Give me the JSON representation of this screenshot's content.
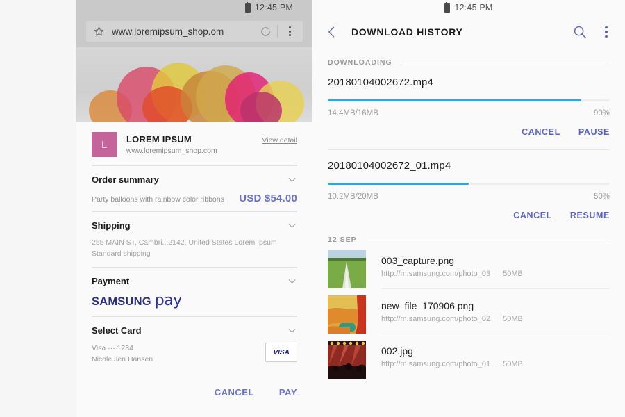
{
  "left": {
    "status": {
      "time": "12:45 PM",
      "battery_icon": "battery-icon"
    },
    "browser": {
      "url": "www.loremipsum_shop.om",
      "star_icon": "star-icon",
      "reload_icon": "reload-icon",
      "menu_icon": "kebab-menu-icon"
    },
    "merchant": {
      "avatar_letter": "L",
      "name": "LOREM IPSUM",
      "url": "www.loremipsum_shop.com",
      "view_detail": "View detail"
    },
    "order": {
      "title": "Order summary",
      "description": "Party balloons with rainbow color ribbons",
      "price": "USD $54.00"
    },
    "shipping": {
      "title": "Shipping",
      "address": "255 MAIN ST, Cambri...2142, United States Lorem Ipsum",
      "method": "Standard shipping"
    },
    "payment": {
      "title": "Payment",
      "brand_first": "SAMSUNG",
      "brand_second": "pay"
    },
    "card": {
      "title": "Select Card",
      "number": "Visa ··· 1234",
      "holder": "Nicole Jen Hansen",
      "badge": "VISA"
    },
    "actions": {
      "cancel": "CANCEL",
      "pay": "PAY"
    },
    "colors": {
      "price": "#6b73c9",
      "accent": "#6b73c9",
      "avatar": "#c4649a",
      "samsung_pay": "#2b2f86"
    }
  },
  "right": {
    "status": {
      "time": "12:45 PM",
      "battery_icon": "battery-icon"
    },
    "appbar": {
      "title": "DOWNLOAD HISTORY",
      "back_icon": "back-chevron-icon",
      "search_icon": "search-icon",
      "menu_icon": "kebab-menu-icon"
    },
    "downloading_label": "DOWNLOADING",
    "downloads": [
      {
        "name": "20180104002672.mp4",
        "size": "14.4MB/16MB",
        "percent": "90%",
        "progress": 90,
        "primary_action": "PAUSE",
        "secondary_action": "CANCEL"
      },
      {
        "name": "20180104002672_01.mp4",
        "size": "10.2MB/20MB",
        "percent": "50%",
        "progress": 50,
        "primary_action": "RESUME",
        "secondary_action": "CANCEL"
      }
    ],
    "date_label": "12 SEP",
    "files": [
      {
        "name": "003_capture.png",
        "url": "http://m.samsung.com/photo_03",
        "size": "50MB",
        "thumb": "green-field-thumbnail"
      },
      {
        "name": "new_file_170906.png",
        "url": "http://m.samsung.com/photo_02",
        "size": "50MB",
        "thumb": "orange-abstract-thumbnail"
      },
      {
        "name": "002.jpg",
        "url": "http://m.samsung.com/photo_01",
        "size": "50MB",
        "thumb": "concert-crowd-thumbnail"
      }
    ],
    "colors": {
      "accent": "#5b63c4",
      "progress": "#2ca8e0",
      "progress_track": "#eeeeee"
    }
  }
}
